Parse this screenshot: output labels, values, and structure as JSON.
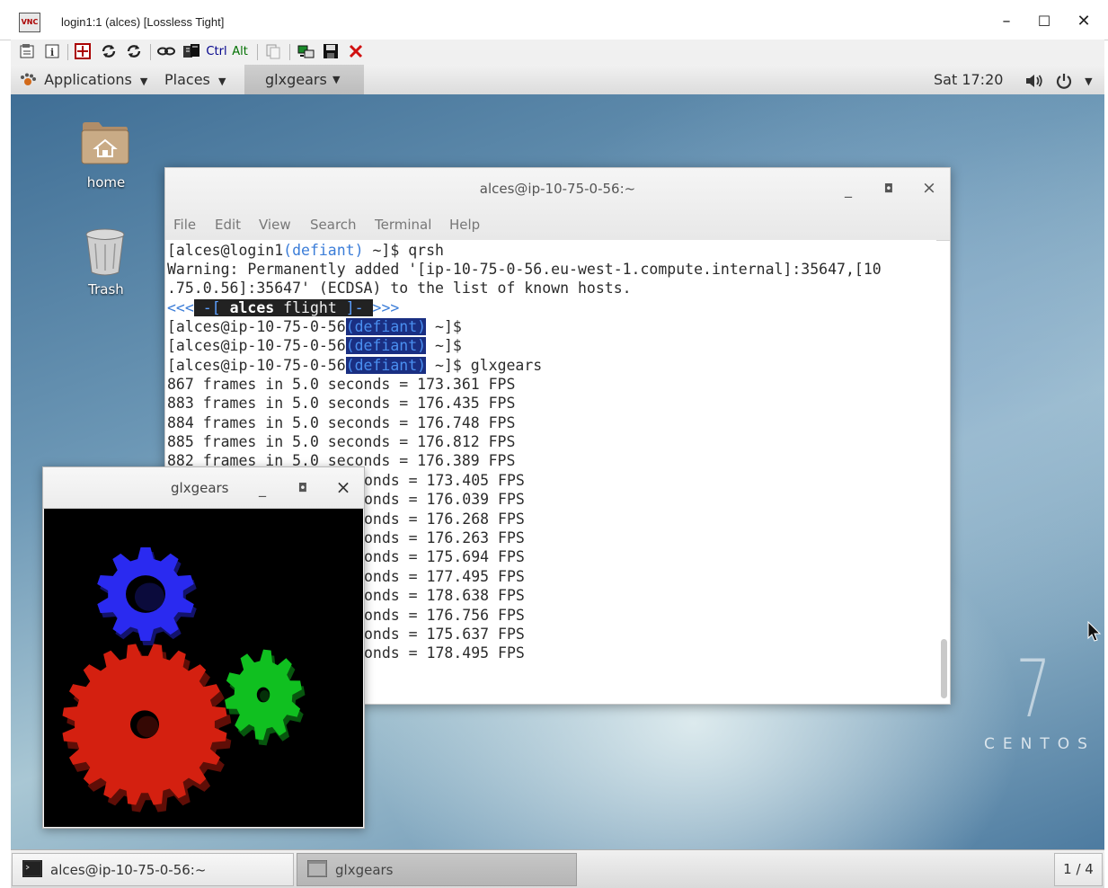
{
  "vnc": {
    "title": "login1:1 (alces) [Lossless Tight]",
    "logo_text": "VNC",
    "minimize": "–",
    "maximize": "☐",
    "close": "✕",
    "toolbar": {
      "ctrl": "Ctrl",
      "alt": "Alt"
    }
  },
  "top_panel": {
    "applications": "Applications",
    "places": "Places",
    "task": "glxgears",
    "clock": "Sat 17:20"
  },
  "desktop": {
    "home_label": "home",
    "trash_label": "Trash",
    "centos_number": "7",
    "centos_word": "CENTOS"
  },
  "terminal": {
    "title": "alces@ip-10-75-0-56:~",
    "menu": [
      "File",
      "Edit",
      "View",
      "Search",
      "Terminal",
      "Help"
    ],
    "lines": {
      "l1_a": "[alces@login1",
      "l1_b": "(defiant)",
      "l1_c": " ~]$ qrsh",
      "l2": "Warning: Permanently added '[ip-10-75-0-56.eu-west-1.compute.internal]:35647,[10",
      "l3": ".75.0.56]:35647' (ECDSA) to the list of known hosts.",
      "banner_l": "<<<",
      "banner_open": " -[ ",
      "banner_bold": "alces",
      "banner_text": " flight ",
      "banner_close": "]- ",
      "banner_r": ">>>",
      "prompt_a": "[alces@ip-10-75-0-56",
      "prompt_b": "(defiant)",
      "prompt_c": " ~]$",
      "prompt_c3": " ~]$ glxgears"
    },
    "fps_lines": [
      "867 frames in 5.0 seconds = 173.361 FPS",
      "883 frames in 5.0 seconds = 176.435 FPS",
      "884 frames in 5.0 seconds = 176.748 FPS",
      "885 frames in 5.0 seconds = 176.812 FPS",
      "882 frames in 5.0 seconds = 176.389 FPS",
      "onds = 173.405 FPS",
      "onds = 176.039 FPS",
      "onds = 176.268 FPS",
      "onds = 176.263 FPS",
      "onds = 175.694 FPS",
      "onds = 177.495 FPS",
      "onds = 178.638 FPS",
      "onds = 176.756 FPS",
      "onds = 175.637 FPS",
      "onds = 178.495 FPS"
    ],
    "wbtn_min": "_",
    "wbtn_max": "◘",
    "wbtn_close": "×"
  },
  "glxgears": {
    "title": "glxgears",
    "wbtn_min": "_",
    "wbtn_max": "◘",
    "wbtn_close": "×",
    "gear_colors": {
      "blue": "#2a2af0",
      "red": "#d42010",
      "green": "#10c020"
    }
  },
  "taskbar": {
    "terminal_task": "alces@ip-10-75-0-56:~",
    "glxgears_task": "glxgears",
    "workspace": "1 / 4"
  }
}
